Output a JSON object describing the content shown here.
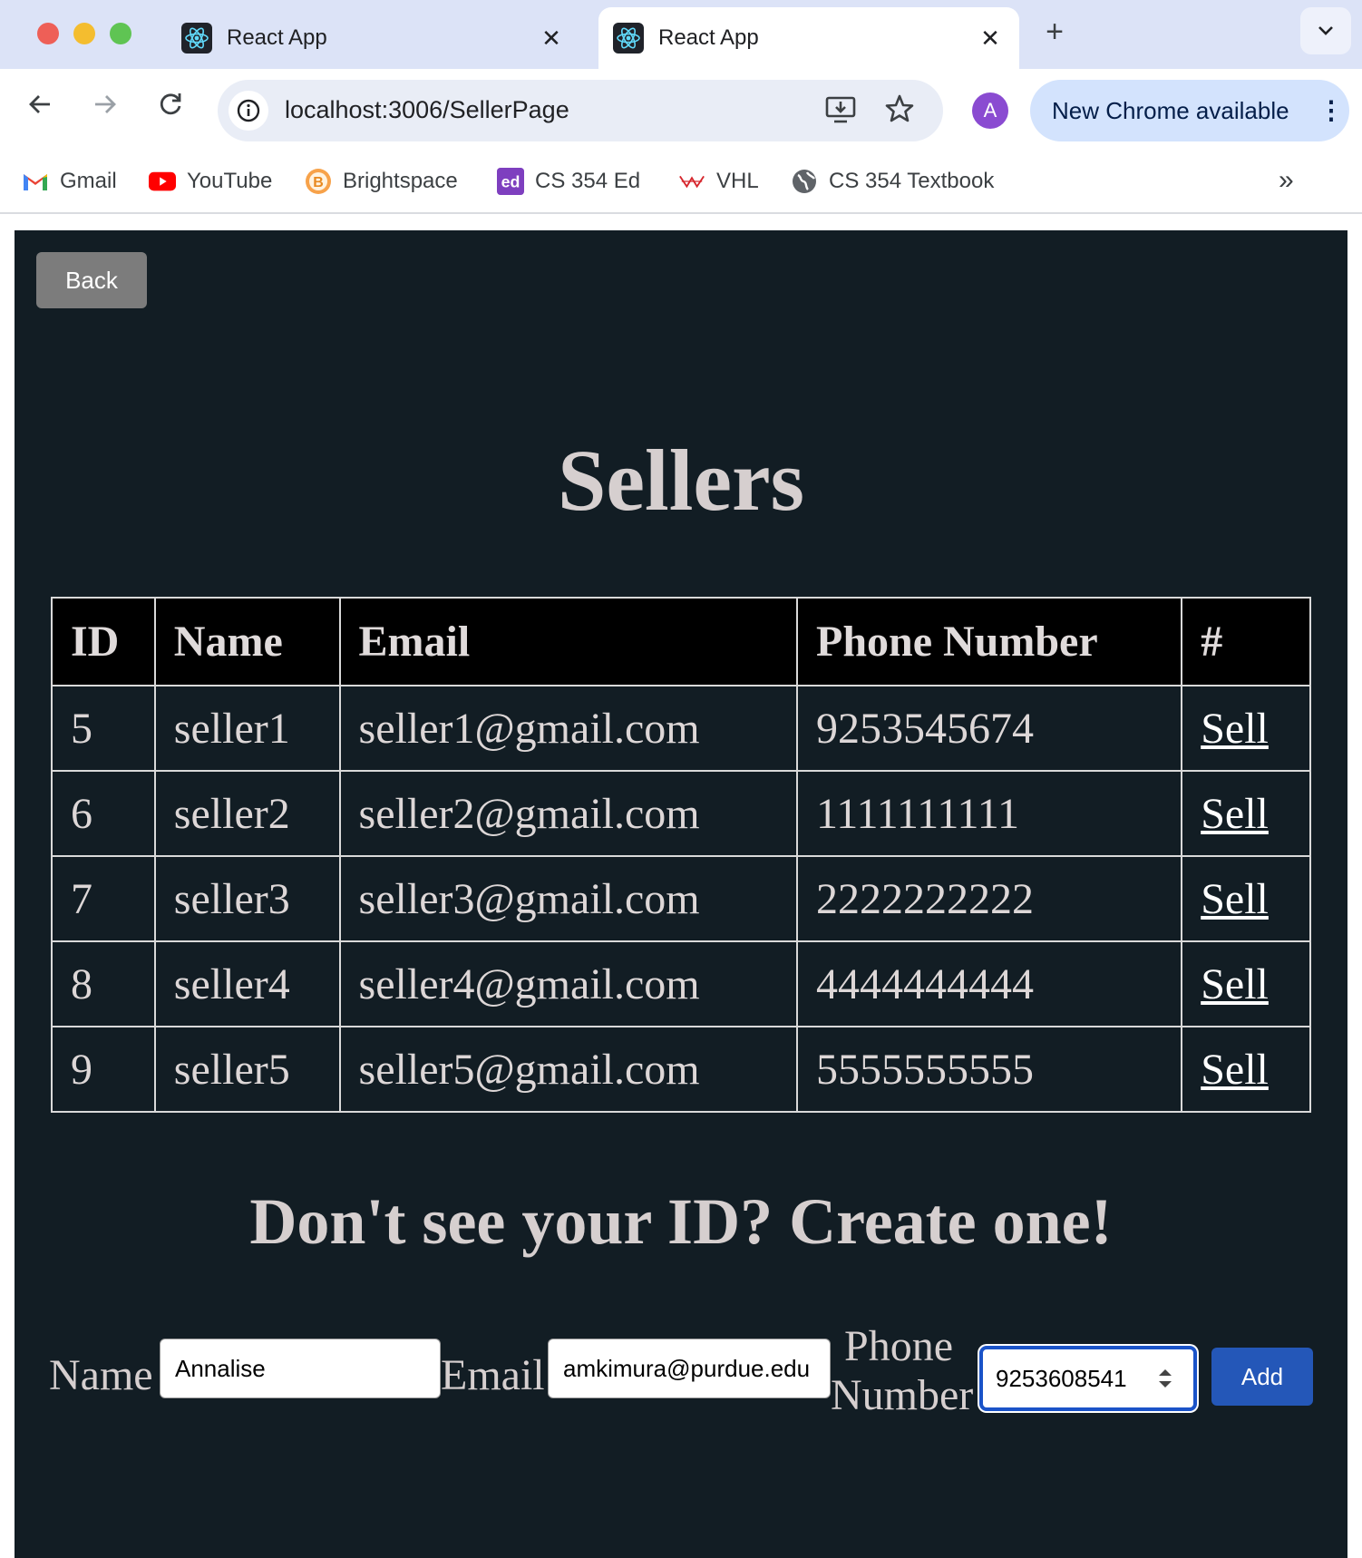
{
  "browser": {
    "tabs": [
      {
        "title": "React App",
        "active": false
      },
      {
        "title": "React App",
        "active": true
      }
    ],
    "url": "localhost:3006/SellerPage",
    "profile_initial": "A",
    "update_label": "New Chrome available",
    "bookmarks": [
      {
        "label": "Gmail",
        "icon": "gmail-icon"
      },
      {
        "label": "YouTube",
        "icon": "youtube-icon"
      },
      {
        "label": "Brightspace",
        "icon": "brightspace-icon"
      },
      {
        "label": "CS 354 Ed",
        "icon": "ed-icon"
      },
      {
        "label": "VHL",
        "icon": "vhl-icon"
      },
      {
        "label": "CS 354 Textbook",
        "icon": "globe-icon"
      }
    ]
  },
  "page": {
    "back_label": "Back",
    "title": "Sellers",
    "table": {
      "headers": [
        "ID",
        "Name",
        "Email",
        "Phone Number",
        "#"
      ],
      "rows": [
        {
          "id": "5",
          "name": "seller1",
          "email": "seller1@gmail.com",
          "phone": "9253545674",
          "action": "Sell"
        },
        {
          "id": "6",
          "name": "seller2",
          "email": "seller2@gmail.com",
          "phone": "1111111111",
          "action": "Sell"
        },
        {
          "id": "7",
          "name": "seller3",
          "email": "seller3@gmail.com",
          "phone": "2222222222",
          "action": "Sell"
        },
        {
          "id": "8",
          "name": "seller4",
          "email": "seller4@gmail.com",
          "phone": "4444444444",
          "action": "Sell"
        },
        {
          "id": "9",
          "name": "seller5",
          "email": "seller5@gmail.com",
          "phone": "5555555555",
          "action": "Sell"
        }
      ]
    },
    "create_heading": "Don't see your ID? Create one!",
    "form": {
      "name_label": "Name",
      "name_value": "Annalise",
      "email_label": "Email",
      "email_value": "amkimura@purdue.edu",
      "phone_label_line1": "Phone",
      "phone_label_line2": "Number",
      "phone_value": "9253608541",
      "add_label": "Add"
    }
  },
  "colors": {
    "page_bg": "#121d24",
    "table_header_bg": "#000000",
    "add_button": "#2457b8",
    "back_button": "#7c7c7c"
  }
}
